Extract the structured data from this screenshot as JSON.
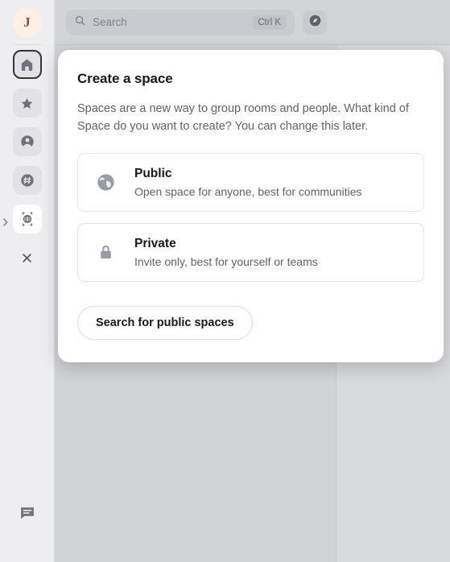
{
  "rail": {
    "avatar": {
      "initial": "J",
      "name": "user-avatar"
    },
    "items": [
      {
        "label": "Home",
        "icon": "home-icon",
        "selected": true
      },
      {
        "label": "Favourites",
        "icon": "star-icon",
        "selected": false
      },
      {
        "label": "People",
        "icon": "person-icon",
        "selected": false
      },
      {
        "label": "Rooms",
        "icon": "hash-icon",
        "selected": false
      },
      {
        "label": "Create a space",
        "icon": "globe-icon",
        "selected": false
      },
      {
        "label": "Close",
        "icon": "close-icon",
        "selected": false
      }
    ],
    "expand_label": "Expand",
    "threads_label": "Threads"
  },
  "topbar": {
    "search": {
      "placeholder": "Search",
      "value": "",
      "shortcut": "Ctrl K",
      "icon": "search-icon"
    },
    "explore": {
      "label": "Explore rooms",
      "icon": "compass-icon"
    }
  },
  "modal": {
    "title": "Create a space",
    "description": "Spaces are a new way to group rooms and people. What kind of Space do you want to create? You can change this later.",
    "options": [
      {
        "id": "public",
        "title": "Public",
        "subtitle": "Open space for anyone, best for communities",
        "icon": "globe-icon"
      },
      {
        "id": "private",
        "title": "Private",
        "subtitle": "Invite only, best for yourself or teams",
        "icon": "lock-icon"
      }
    ],
    "search_button": "Search for public spaces"
  },
  "colors": {
    "rail_bg": "#ececee",
    "app_bg": "#cdced2",
    "accent_text": "#17181c",
    "muted_text": "#61636c",
    "avatar_bg": "#feeee1",
    "avatar_fg": "#8d2f1d"
  }
}
